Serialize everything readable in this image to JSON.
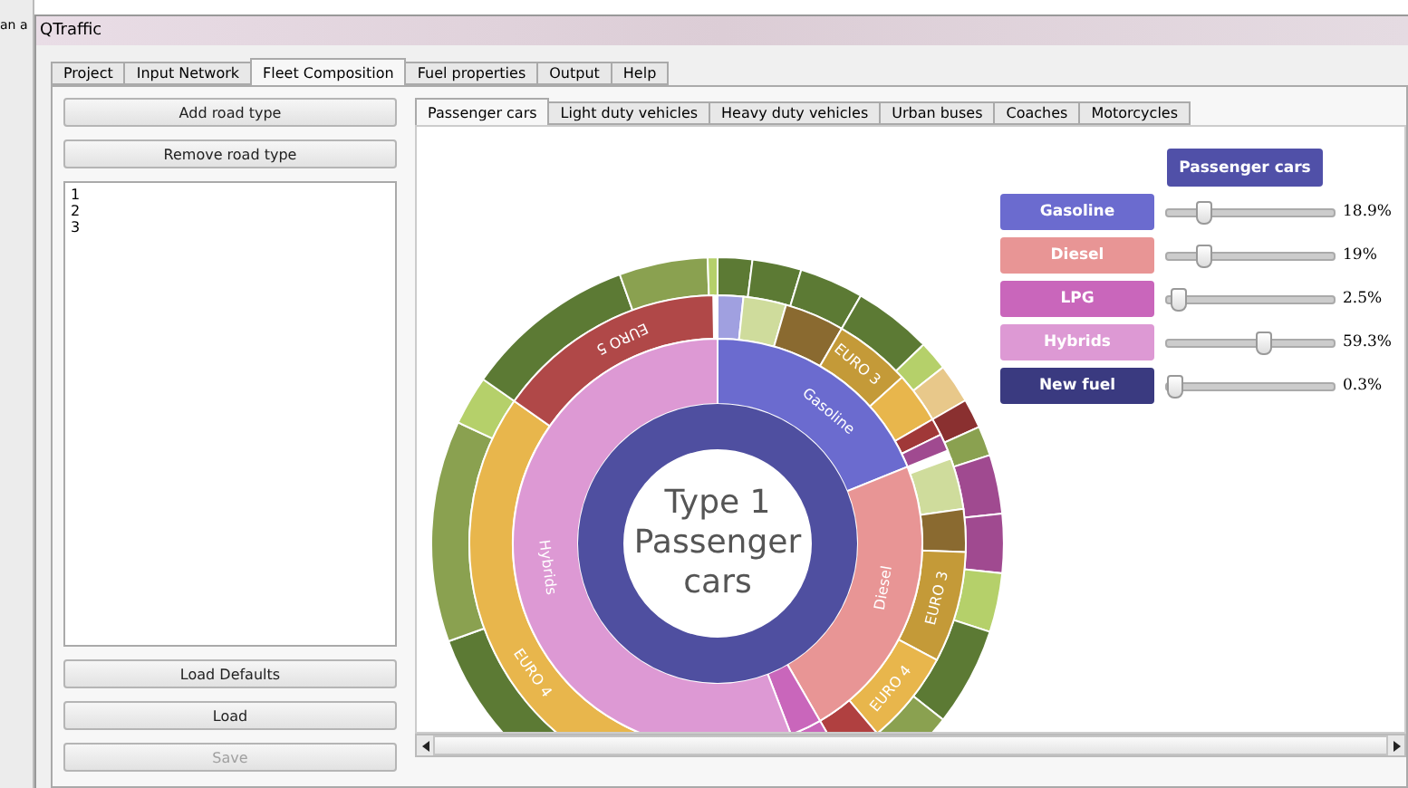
{
  "background_window": {
    "text": "an a"
  },
  "window": {
    "title": "QTraffic"
  },
  "tabs": [
    {
      "label": "Project",
      "selected": false
    },
    {
      "label": "Input Network",
      "selected": false
    },
    {
      "label": "Fleet Composition",
      "selected": true
    },
    {
      "label": "Fuel properties",
      "selected": false
    },
    {
      "label": "Output",
      "selected": false
    },
    {
      "label": "Help",
      "selected": false
    }
  ],
  "road_type_buttons": [
    {
      "label": "Add road type",
      "disabled": false
    },
    {
      "label": "Remove road type",
      "disabled": false
    }
  ],
  "road_types": [
    "1",
    "2",
    "3"
  ],
  "file_buttons": [
    {
      "label": "Load Defaults",
      "disabled": false
    },
    {
      "label": "Load",
      "disabled": false
    },
    {
      "label": "Save",
      "disabled": true
    }
  ],
  "vehicle_tabs": [
    {
      "label": "Passenger cars",
      "selected": true
    },
    {
      "label": "Light duty vehicles",
      "selected": false
    },
    {
      "label": "Heavy duty vehicles",
      "selected": false
    },
    {
      "label": "Urban buses",
      "selected": false
    },
    {
      "label": "Coaches",
      "selected": false
    },
    {
      "label": "Motorcycles",
      "selected": false
    }
  ],
  "sunburst": {
    "center_lines": [
      "Type 1",
      "Passenger",
      "cars"
    ],
    "segment_labels": [
      {
        "text": "Gasoline"
      },
      {
        "text": "Diesel"
      },
      {
        "text": "Hybrids"
      },
      {
        "text": "EURO 3"
      },
      {
        "text": "EURO 3"
      },
      {
        "text": "EURO 4"
      },
      {
        "text": "EURO 5"
      },
      {
        "text": "EURO 4"
      }
    ]
  },
  "legend": {
    "header": "Passenger cars",
    "fuels": [
      {
        "name": "Gasoline",
        "color": "#6b6bcf",
        "level": 0.19,
        "reading": "18.9%"
      },
      {
        "name": "Diesel",
        "color": "#e89595",
        "level": 0.19,
        "reading": "19%"
      },
      {
        "name": "LPG",
        "color": "#c966bb",
        "level": 0.02,
        "reading": "2.5%"
      },
      {
        "name": "Hybrids",
        "color": "#dd99d4",
        "level": 0.59,
        "reading": "59.3%"
      },
      {
        "name": "New fuel",
        "color": "#3a3a80",
        "level": 0.0,
        "reading": "0.3%"
      }
    ]
  }
}
